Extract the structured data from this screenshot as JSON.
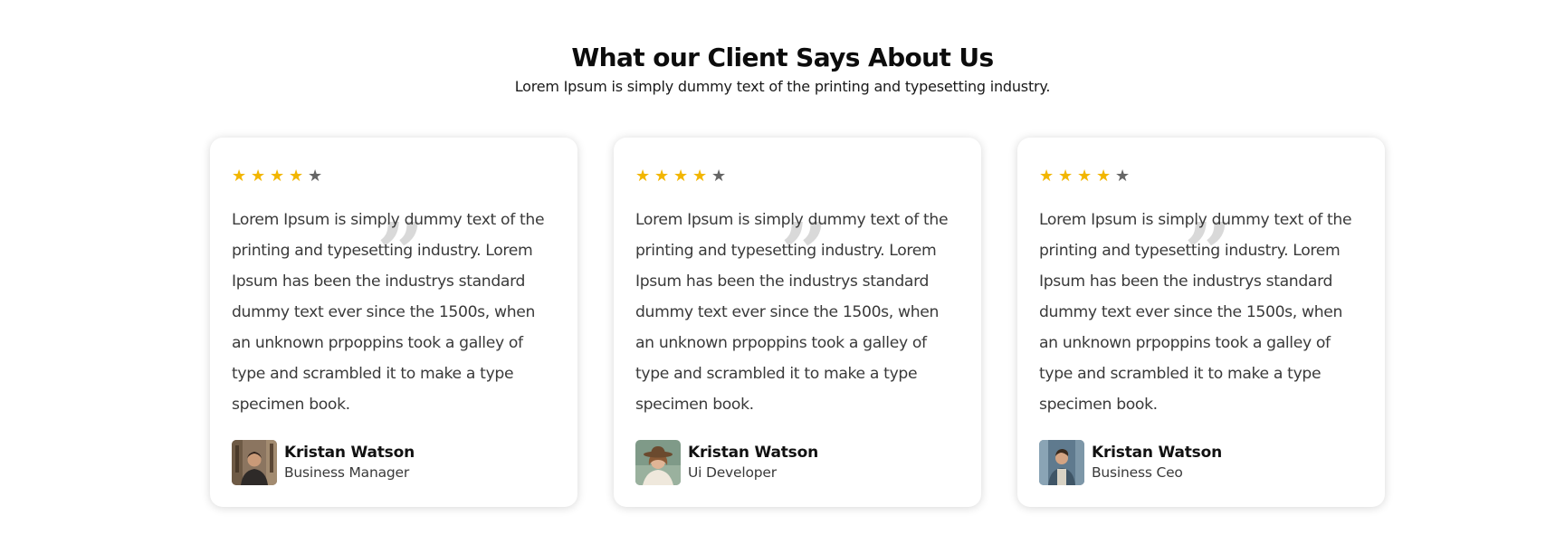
{
  "section": {
    "title": "What our Client Says About Us",
    "subtitle": "Lorem Ipsum is simply dummy text of the printing and typesetting industry."
  },
  "colors": {
    "star_filled": "#f2b600",
    "star_empty": "#666666",
    "quote_mark": "#d9d9d9"
  },
  "icons": {
    "star": "star-icon",
    "quote": "quote-icon"
  },
  "testimonials": [
    {
      "rating": 4,
      "max_rating": 5,
      "text": "Lorem Ipsum is simply dummy text of the printing and typesetting industry. Lorem Ipsum has been the industrys standard dummy text ever since the 1500s, when an unknown prpoppins took a galley of type and scrambled it to make a type specimen book.",
      "name": "Kristan Watson",
      "role": "Business Manager"
    },
    {
      "rating": 4,
      "max_rating": 5,
      "text": "Lorem Ipsum is simply dummy text of the printing and typesetting industry. Lorem Ipsum has been the industrys standard dummy text ever since the 1500s, when an unknown prpoppins took a galley of type and scrambled it to make a type specimen book.",
      "name": "Kristan Watson",
      "role": "Ui Developer"
    },
    {
      "rating": 4,
      "max_rating": 5,
      "text": "Lorem Ipsum is simply dummy text of the printing and typesetting industry. Lorem Ipsum has been the industrys standard dummy text ever since the 1500s, when an unknown prpoppins took a galley of type and scrambled it to make a type specimen book.",
      "name": "Kristan Watson",
      "role": "Business Ceo"
    }
  ]
}
